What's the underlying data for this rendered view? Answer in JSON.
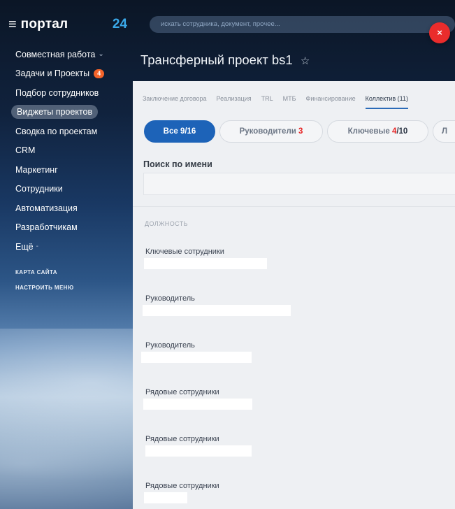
{
  "sidebar": {
    "logo": "портал",
    "logo_num": "24",
    "items": [
      {
        "label": "Совместная работа",
        "chevron": "⌄"
      },
      {
        "label": "Задачи и Проекты",
        "badge": "4"
      },
      {
        "label": "Подбор сотрудников"
      },
      {
        "label": "Виджеты проектов",
        "active": true
      },
      {
        "label": "Сводка по проектам"
      },
      {
        "label": "CRM"
      },
      {
        "label": "Маркетинг"
      },
      {
        "label": "Сотрудники"
      },
      {
        "label": "Автоматизация"
      },
      {
        "label": "Разработчикам"
      },
      {
        "label": "Ещё",
        "chevron": "-"
      }
    ],
    "links": [
      "КАРТА САЙТА",
      "НАСТРОИТЬ МЕНЮ"
    ]
  },
  "topbar": {
    "search_placeholder": "искать сотрудника, документ, прочее..."
  },
  "close_label": "×",
  "panel": {
    "title": "Трансферный проект bs1",
    "star": "☆",
    "tabs": [
      "Заключение договора",
      "Реализация",
      "TRL",
      "МТБ",
      "Финансирование",
      "Коллектив (11)"
    ],
    "active_tab": 5,
    "filters": {
      "all": "Все 9/16",
      "leaders_label": "Руководители",
      "leaders_count": "3",
      "key_label": "Ключевые",
      "key_num": "4",
      "key_total": "/10",
      "more": "Л"
    },
    "search_label": "Поиск по имени",
    "column_header": "ДОЛЖНОСТЬ",
    "rows": [
      {
        "role": "Ключевые сотрудники"
      },
      {
        "role": "Руководитель"
      },
      {
        "role": "Руководитель"
      },
      {
        "role": "Рядовые сотрудники"
      },
      {
        "role": "Рядовые сотрудники"
      },
      {
        "role": "Рядовые сотрудники"
      }
    ]
  },
  "colors": {
    "accent": "#1d63b8",
    "badge": "#f5642a",
    "close": "#ea2c2c",
    "count_red": "#e62525",
    "logo_num": "#3aa8e8"
  }
}
